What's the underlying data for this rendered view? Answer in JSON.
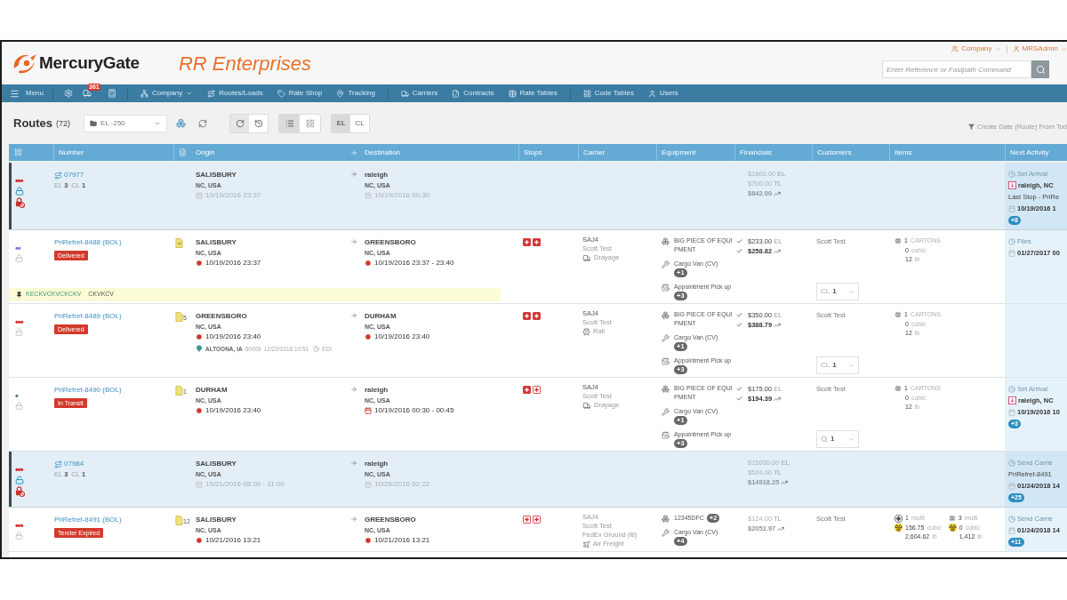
{
  "header": {
    "logo": "MercuryGate",
    "company": "RR Enterprises",
    "account_menus": [
      {
        "label": "Company"
      },
      {
        "label": "MRSAdmin"
      }
    ],
    "search": {
      "placeholder": "Enter Reference or Fastpath Command"
    }
  },
  "nav": {
    "menu": "Menu",
    "alert_count": "361",
    "items": [
      {
        "label": "Company",
        "dropdown": true
      },
      {
        "label": "Routes/Loads",
        "dropdown": false
      },
      {
        "label": "Rate Shop",
        "dropdown": false
      },
      {
        "label": "Tracking",
        "dropdown": false
      },
      {
        "label": "Carriers",
        "dropdown": false
      },
      {
        "label": "Contracts",
        "dropdown": false
      },
      {
        "label": "Rate Tables",
        "dropdown": false
      },
      {
        "label": "Code Tables",
        "dropdown": false
      },
      {
        "label": "Users",
        "dropdown": false
      }
    ]
  },
  "toolbar": {
    "title": "Routes",
    "count": "(72)",
    "view": "EL -250",
    "view_modes": [
      {
        "selected": true
      },
      {
        "selected": false
      }
    ],
    "level_modes": [
      {
        "label": "EL",
        "selected": true
      },
      {
        "label": "CL",
        "selected": false
      }
    ],
    "filter": "Create Date (Route) From Tod"
  },
  "columns": [
    {
      "label": "Number"
    },
    {
      "label": "Origin"
    },
    {
      "label": "Destination"
    },
    {
      "label": "Stops"
    },
    {
      "label": "Carrier"
    },
    {
      "label": "Equipment"
    },
    {
      "label": "Financials"
    },
    {
      "label": "Customers"
    },
    {
      "label": "Items"
    },
    {
      "label": "Next Activity"
    }
  ],
  "rows": [
    {
      "kind": "load",
      "status": {
        "marks": "•••",
        "color": "#d42a2a"
      },
      "locked": true,
      "number": "07977",
      "counts": [
        {
          "label": "EL",
          "value": "3"
        },
        {
          "label": "CL",
          "value": "1"
        }
      ],
      "origin": {
        "city": "SALISBURY",
        "region": "NC, USA",
        "time": "10/19/2016 23:37",
        "kind": "planned"
      },
      "destination": {
        "city": "raleigh",
        "region": "NC, USA",
        "time": "10/19/2016 00:30",
        "kind": "planned"
      },
      "financials": [
        {
          "kind": "line",
          "amount": "$1600.00",
          "tag": "EL",
          "checked": false
        },
        {
          "kind": "line",
          "amount": "$700.00",
          "tag": "TL",
          "checked": false
        },
        {
          "kind": "total",
          "amount": "$842.00",
          "checked": false
        }
      ],
      "next": {
        "action": "Set Arrival",
        "place": "raleigh, NC",
        "detail": "Last Stop - PriRe",
        "time": "10/19/2016 1",
        "badge": "+8"
      }
    },
    {
      "kind": "shipment",
      "status": {
        "marks": "••",
        "color": "#7c7cdc"
      },
      "number": "PriRefref-8488 (BOL)",
      "status_badge": "Delivered",
      "docs": {
        "kind": "arrow"
      },
      "origin": {
        "city": "SALISBURY",
        "region": "NC, USA",
        "time": "10/19/2016 23:37",
        "kind": "actual"
      },
      "destination": {
        "city": "GREENSBORO",
        "region": "NC, USA",
        "time": "10/19/2016 23:37 - 23:40",
        "kind": "actual"
      },
      "stops": [
        {
          "done": true
        },
        {
          "done": true
        }
      ],
      "carrier": {
        "scac": "SAJ4",
        "name": "Scott Test",
        "mode": "Drayage",
        "kind": "truck"
      },
      "equipment": [
        {
          "kind": "equipment",
          "label": "BIG PIECE OF EQUIPMENT"
        },
        {
          "kind": "vehicle",
          "label": "Cargo Van (CV)",
          "badge": "+1"
        },
        {
          "kind": "appointment",
          "label": "Appointment Pick up",
          "badge": "+3"
        }
      ],
      "financials": [
        {
          "kind": "line",
          "amount": "$233.00",
          "tag": "EL",
          "checked": true
        },
        {
          "kind": "total",
          "amount": "$258.82",
          "checked": true
        }
      ],
      "customer": {
        "name": "Scott Test",
        "filter": {
          "kind": "cl",
          "label": "CL",
          "value": "1"
        }
      },
      "items": [
        {
          "lines": [
            {
              "kind": "shipping",
              "value": "1",
              "unit": "CARTONS"
            },
            {
              "kind": "plain",
              "value": "0",
              "unit": "cubic"
            },
            {
              "kind": "plain",
              "value": "12",
              "unit": "lb"
            }
          ]
        }
      ],
      "next": {
        "action": "Files",
        "time": "01/27/2017 00"
      },
      "note": {
        "author": "KECKVCKVCKCKV",
        "text": "CKVKCV"
      }
    },
    {
      "kind": "shipment",
      "status": {
        "marks": "•••",
        "color": "#d42a2a"
      },
      "number": "PriRefref-8489 (BOL)",
      "status_badge": "Delivered",
      "docs": {
        "kind": "count",
        "count": "5"
      },
      "origin": {
        "city": "GREENSBORO",
        "region": "NC, USA",
        "time": "10/19/2016 23:40",
        "kind": "actual",
        "last_location": {
          "place": "ALTOONA, IA",
          "postal": "50009",
          "time": "12/22/2016 10:51",
          "source": "EDI"
        }
      },
      "destination": {
        "city": "DURHAM",
        "region": "NC, USA",
        "time": "10/19/2016 23:40",
        "kind": "actual"
      },
      "stops": [
        {
          "done": true
        },
        {
          "done": true
        }
      ],
      "carrier": {
        "scac": "SAJ4",
        "name": "Scott Test",
        "mode": "Rail",
        "kind": "rail"
      },
      "equipment": [
        {
          "kind": "equipment",
          "label": "BIG PIECE OF EQUIPMENT"
        },
        {
          "kind": "vehicle",
          "label": "Cargo Van (CV)",
          "badge": "+1"
        },
        {
          "kind": "appointment",
          "label": "Appointment Pick up",
          "badge": "+3"
        }
      ],
      "financials": [
        {
          "kind": "line",
          "amount": "$350.00",
          "tag": "EL",
          "checked": true
        },
        {
          "kind": "total",
          "amount": "$388.79",
          "checked": true
        }
      ],
      "customer": {
        "name": "Scott Test",
        "filter": {
          "kind": "cl",
          "label": "CL",
          "value": "1"
        }
      },
      "items": [
        {
          "lines": [
            {
              "kind": "shipping",
              "value": "1",
              "unit": "CARTONS"
            },
            {
              "kind": "plain",
              "value": "0",
              "unit": "cubic"
            },
            {
              "kind": "plain",
              "value": "12",
              "unit": "lb"
            }
          ]
        }
      ]
    },
    {
      "kind": "shipment",
      "status": {
        "marks": "•",
        "color": "#4d7d57"
      },
      "number": "PriRefref-8490 (BOL)",
      "status_badge": "In Transit",
      "docs": {
        "kind": "count",
        "count": "1"
      },
      "origin": {
        "city": "DURHAM",
        "region": "NC, USA",
        "time": "10/19/2016 23:40",
        "kind": "actual"
      },
      "destination": {
        "city": "raleigh",
        "region": "NC, USA",
        "time": "10/19/2016 00:30 - 00:45",
        "kind": "appointment"
      },
      "stops": [
        {
          "done": true
        },
        {
          "done": false
        }
      ],
      "carrier": {
        "scac": "SAJ4",
        "name": "Scott Test",
        "mode": "Drayage",
        "kind": "truck"
      },
      "equipment": [
        {
          "kind": "equipment",
          "label": "BIG PIECE OF EQUIPMENT"
        },
        {
          "kind": "vehicle",
          "label": "Cargo Van (CV)",
          "badge": "+1"
        },
        {
          "kind": "appointment",
          "label": "Appointment Pick up",
          "badge": "+3"
        }
      ],
      "financials": [
        {
          "kind": "line",
          "amount": "$175.00",
          "tag": "EL",
          "checked": true
        },
        {
          "kind": "total",
          "amount": "$194.39",
          "checked": true
        }
      ],
      "customer": {
        "name": "Scott Test",
        "filter": {
          "kind": "search",
          "value": "1"
        }
      },
      "items": [
        {
          "lines": [
            {
              "kind": "shipping",
              "value": "1",
              "unit": "CARTONS"
            },
            {
              "kind": "plain",
              "value": "0",
              "unit": "cubic"
            },
            {
              "kind": "plain",
              "value": "12",
              "unit": "lb"
            }
          ]
        }
      ],
      "next": {
        "action": "Set Arrival",
        "place": "raleigh, NC",
        "time": "10/19/2016 10",
        "badge": "+3"
      }
    },
    {
      "kind": "load",
      "status": {
        "marks": "•••",
        "color": "#d42a2a"
      },
      "locked": false,
      "number": "07984",
      "counts": [
        {
          "label": "EL",
          "value": "3"
        },
        {
          "label": "CL",
          "value": "1"
        }
      ],
      "origin": {
        "city": "SALISBURY",
        "region": "NC, USA",
        "time": "10/21/2016 08:00 - 11:00",
        "kind": "planned"
      },
      "destination": {
        "city": "raleigh",
        "region": "NC, USA",
        "time": "10/26/2016 02:22",
        "kind": "planned"
      },
      "financials": [
        {
          "kind": "line",
          "amount": "$15000.00",
          "tag": "EL",
          "checked": false
        },
        {
          "kind": "line",
          "amount": "$524.00",
          "tag": "TL",
          "checked": false
        },
        {
          "kind": "total",
          "amount": "$14918.25",
          "checked": false
        }
      ],
      "next": {
        "action": "Send Carrie",
        "detail": "PriRefref-8491",
        "time": "01/24/2018 14",
        "badge": "+25"
      }
    },
    {
      "kind": "shipment",
      "status": {
        "marks": "•••",
        "color": "#d42a2a"
      },
      "number": "PriRefref-8491 (BOL)",
      "status_badge": "Tender Expired",
      "docs": {
        "kind": "count",
        "count": "12"
      },
      "origin": {
        "city": "SALISBURY",
        "region": "NC, USA",
        "time": "10/21/2016 13:21",
        "kind": "actual"
      },
      "destination": {
        "city": "GREENSBORO",
        "region": "NC, USA",
        "time": "10/21/2016 13:21",
        "kind": "actual"
      },
      "stops": [
        {
          "done": false
        },
        {
          "done": false
        }
      ],
      "carrier": {
        "scac": "SAJ4",
        "name": "Scott Test",
        "service": "FedEx Ground (ltl)",
        "mode": "Air Freight",
        "kind": "air"
      },
      "equipment": [
        {
          "kind": "equipment",
          "label": "12345DFC",
          "badge": "+2"
        },
        {
          "kind": "vehicle",
          "label": "Cargo Van (CV)",
          "badge": "+4"
        }
      ],
      "financials": [
        {
          "kind": "line",
          "amount": "$124.00",
          "tag": "TL",
          "checked": false
        },
        {
          "kind": "total",
          "amount": "$2052.97",
          "checked": false
        }
      ],
      "customer": {
        "name": "Scott Test"
      },
      "items": [
        {
          "lines": [
            {
              "kind": "hazmat",
              "value": "1",
              "unit": "multi"
            },
            {
              "kind": "radioactive",
              "value": "156.75",
              "unit": "cubic"
            },
            {
              "kind": "plain",
              "value": "2,604.62",
              "unit": "lb"
            }
          ]
        },
        {
          "lines": [
            {
              "kind": "shipping",
              "value": "3",
              "unit": "multi"
            },
            {
              "kind": "radioactive",
              "value": "0",
              "unit": "cubic"
            },
            {
              "kind": "plain",
              "value": "1,412",
              "unit": "lb"
            }
          ]
        }
      ],
      "next": {
        "action": "Send Carrie",
        "time": "01/24/2018 14",
        "badge": "+11"
      }
    }
  ]
}
